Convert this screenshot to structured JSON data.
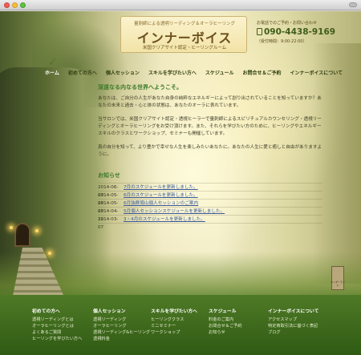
{
  "header": {
    "tagline": "量刺師による透明リーディング＆オーラヒーリング",
    "title": "インナーボイス",
    "subtitle": "米国クリアサイト認定・ヒーリングルーム",
    "contact_label": "お電話でのご予約・お問い合わせ",
    "phone": "090-4438-9169",
    "hours": "（受付時間：9:00-22:00）"
  },
  "nav": {
    "items": [
      {
        "label": "ホーム"
      },
      {
        "label": "初めての方へ"
      },
      {
        "label": "個人セッション"
      },
      {
        "label": "スキルを学びたい方へ"
      },
      {
        "label": "スケジュール"
      },
      {
        "label": "お問合せ＆ご予約"
      },
      {
        "label": "インナーボイスについて"
      }
    ]
  },
  "main": {
    "welcome": "深遠なる内なる世界へようこそ。",
    "paragraphs": [
      "あなたは、ご自分の人生があなた自身の純粋なエネルギーによって創り出されていることを知っていますか？あなたの未来と過去・心と体の状態は、あなたのオーラに表れています。",
      "当サロンでは、米国クリアサイト認定・透視ヒーラーで量刺師によるスピリチュアルカウンセリング・透視リーディングとオーラヒーリングをお受け頂けます。また、それらを学びたい方のために、ヒーリングやエネルギースキルのクラスとワークショップ、セミナーも開催しています。",
      "真の自分を知って、より豊かで幸せな人生を楽しみたいあなたに。あなたの人生に愛と癒しと自由がありますように。"
    ],
    "news_title": "お知らせ",
    "news": [
      {
        "date": "2014-06-07",
        "text": "7月のスケジュールを更新しました。"
      },
      {
        "date": "2014-05-08",
        "text": "6月のスケジュールを更新しました。"
      },
      {
        "date": "2014-05-03",
        "text": "6月強群周山個人セッションのご案内"
      },
      {
        "date": "2014-04-12",
        "text": "5月個人セッションスケジュールを更新しました。"
      },
      {
        "date": "2014-03-07",
        "text": "3・4月のスケジュールを更新しました。"
      }
    ]
  },
  "signpost": "ワンダーランド",
  "footer": {
    "columns": [
      {
        "heading": "初めての方へ",
        "links": [
          "透視リーディングとは",
          "オーラヒーリングとは",
          "よくあるご質問",
          "ヒーリングを学びたい方へ"
        ]
      },
      {
        "heading": "個人セッション",
        "links": [
          "透視リーディング",
          "オーラヒーリング",
          "透視リーディング&ヒーリング",
          "透視料金"
        ]
      },
      {
        "heading": "スキルを学びたい方へ",
        "links": [
          "ヒーリングクラス",
          "ミニセミナー",
          "ワークショップ"
        ]
      },
      {
        "heading": "スケジュール",
        "links": [
          "料金のご案内",
          "お問合せ＆ご予約",
          "お知らせ"
        ]
      },
      {
        "heading": "インナーボイスについて",
        "links": [
          "アクセスマップ",
          "特定商取引法に基づく表記",
          "ブログ"
        ]
      }
    ]
  }
}
